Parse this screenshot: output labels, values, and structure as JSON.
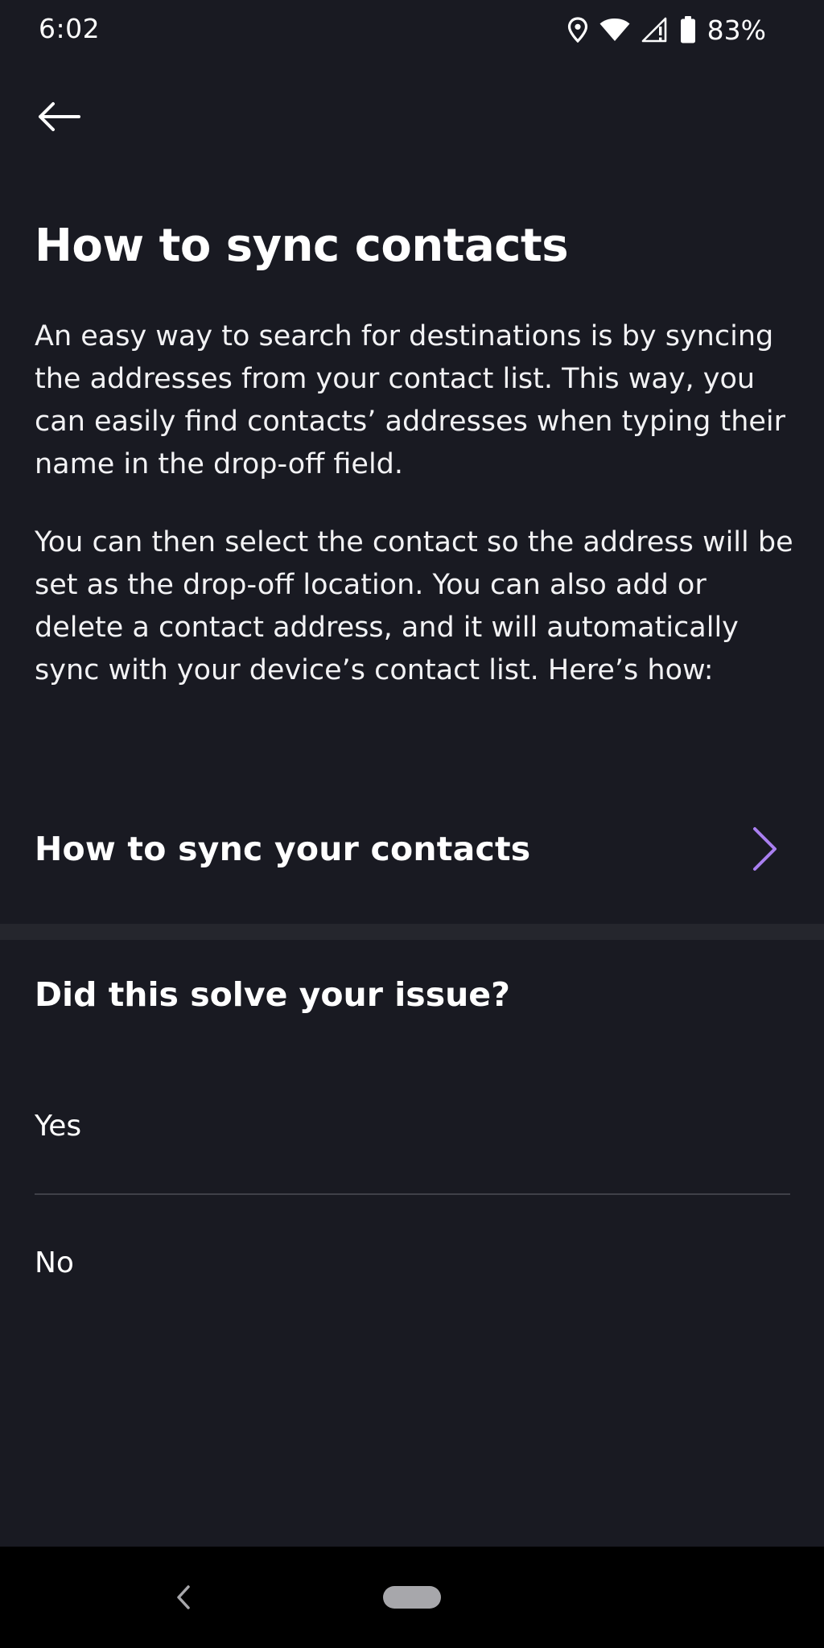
{
  "status_bar": {
    "time": "6:02",
    "battery_percent": "83%",
    "icons": [
      "location-icon",
      "wifi-icon",
      "signal-icon",
      "battery-icon"
    ]
  },
  "header": {
    "back_icon": "arrow-left-icon"
  },
  "article": {
    "title": "How to sync contacts",
    "paragraph_1": "An easy way to search for destinations is by syncing the addresses from your contact list. This way, you can easily find contacts’ addresses when typing their name in the drop-off field.",
    "paragraph_2": "You can then select the contact so the address will be set as the drop-off location. You can also add or delete a contact address, and it will automatically sync with your device’s contact list. Here’s how:",
    "link_label": "How to sync your contacts"
  },
  "feedback": {
    "question": "Did this solve your issue?",
    "yes_label": "Yes",
    "no_label": "No"
  },
  "colors": {
    "background": "#191a22",
    "accent": "#a97ff0",
    "divider": "#25262d"
  }
}
